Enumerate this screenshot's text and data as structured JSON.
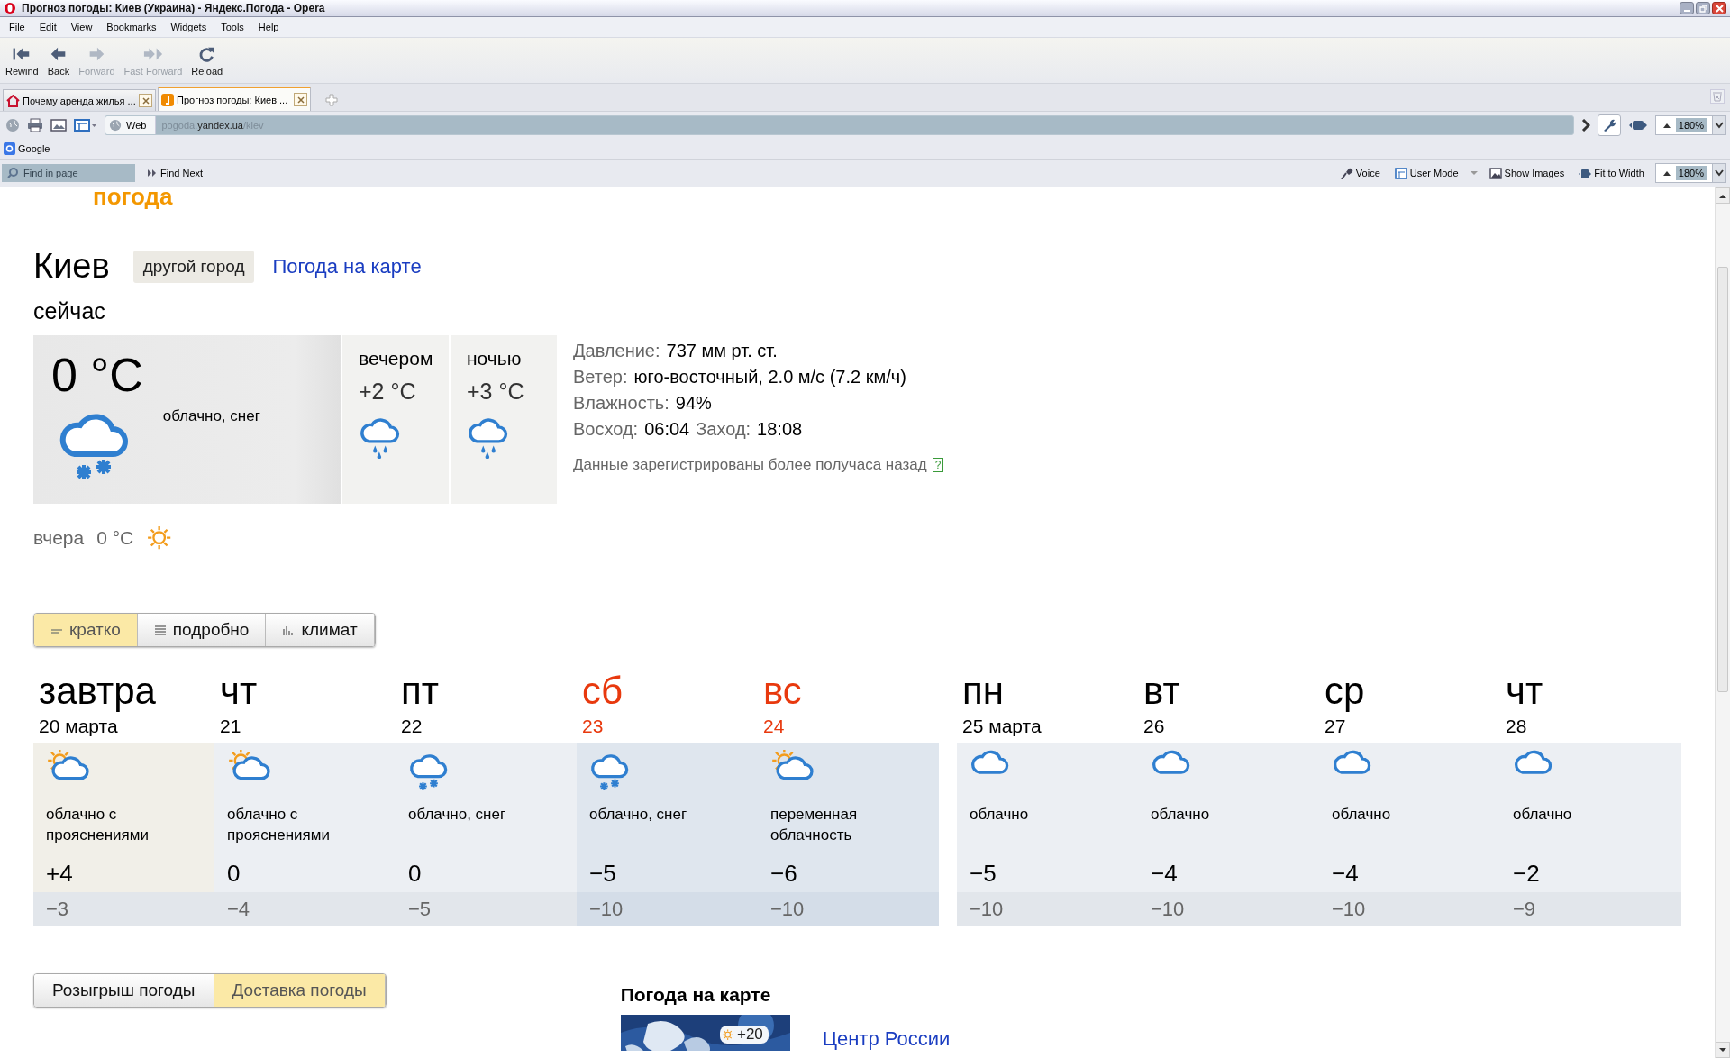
{
  "window": {
    "title": "Прогноз погоды: Киев (Украина) - Яндекс.Погода - Opera"
  },
  "menu": [
    "File",
    "Edit",
    "View",
    "Bookmarks",
    "Widgets",
    "Tools",
    "Help"
  ],
  "toolbar": [
    {
      "label": "Rewind",
      "disabled": false
    },
    {
      "label": "Back",
      "disabled": false
    },
    {
      "label": "Forward",
      "disabled": true
    },
    {
      "label": "Fast Forward",
      "disabled": true
    },
    {
      "label": "Reload",
      "disabled": false
    }
  ],
  "tabs": [
    {
      "title": "Почему аренда жилья ...",
      "selected": false
    },
    {
      "title": "Прогноз погоды: Киев ...",
      "selected": true
    }
  ],
  "address": {
    "scope": "Web",
    "prefix": "pogoda.",
    "host": "yandex.ua",
    "path": "/kiev"
  },
  "zoom": "180%",
  "bookmarks": [
    "Google"
  ],
  "find_bar": {
    "placeholder": "Find in page",
    "button": "Find Next"
  },
  "view_tools": [
    "Voice",
    "User Mode",
    "Show Images",
    "Fit to Width"
  ],
  "find_zoom": "180%",
  "page": {
    "logo": "погода",
    "city": "Киев",
    "other_city": "другой город",
    "map_link": "Погода на карте",
    "now_label": "сейчас",
    "current": {
      "temp": "0 °C",
      "condition": "облачно, снег",
      "kind": "snow"
    },
    "parts": [
      {
        "label": "вечером",
        "temp": "+2 °C",
        "kind": "rain"
      },
      {
        "label": "ночью",
        "temp": "+3 °C",
        "kind": "rain"
      }
    ],
    "details": [
      [
        {
          "label": "Давление:",
          "value": "737 мм рт. ст."
        }
      ],
      [
        {
          "label": "Ветер:",
          "value": "юго-восточный, 2.0 м/с (7.2 км/ч)"
        }
      ],
      [
        {
          "label": "Влажность:",
          "value": "94%"
        }
      ],
      [
        {
          "label": "Восход:",
          "value": "06:04"
        },
        {
          "label": "Заход:",
          "value": "18:08"
        }
      ]
    ],
    "note": "Данные зарегистрированы более получаса назад",
    "help": "?",
    "yesterday": {
      "label": "вчера",
      "temp": "0 °C",
      "kind": "sun"
    },
    "view_tabs": [
      {
        "label": "кратко",
        "selected": true
      },
      {
        "label": "подробно",
        "selected": false
      },
      {
        "label": "климат",
        "selected": false
      }
    ],
    "forecast_groups": [
      [
        {
          "day": "завтра",
          "date": "20 марта",
          "weekend": false,
          "kind": "partly",
          "condition": "облачно с прояснениями",
          "high": "+4",
          "low": "−3"
        },
        {
          "day": "чт",
          "date": "21",
          "weekend": false,
          "kind": "partly",
          "condition": "облачно с прояснениями",
          "high": "0",
          "low": "−4"
        },
        {
          "day": "пт",
          "date": "22",
          "weekend": false,
          "kind": "snow",
          "condition": "облачно, снег",
          "high": "0",
          "low": "−5"
        },
        {
          "day": "сб",
          "date": "23",
          "weekend": true,
          "kind": "snow",
          "condition": "облачно, снег",
          "high": "−5",
          "low": "−10"
        },
        {
          "day": "вс",
          "date": "24",
          "weekend": true,
          "kind": "partly",
          "condition": "переменная облачность",
          "high": "−6",
          "low": "−10"
        }
      ],
      [
        {
          "day": "пн",
          "date": "25 марта",
          "weekend": false,
          "kind": "cloud",
          "condition": "облачно",
          "high": "−5",
          "low": "−10"
        },
        {
          "day": "вт",
          "date": "26",
          "weekend": false,
          "kind": "cloud",
          "condition": "облачно",
          "high": "−4",
          "low": "−10"
        },
        {
          "day": "ср",
          "date": "27",
          "weekend": false,
          "kind": "cloud",
          "condition": "облачно",
          "high": "−4",
          "low": "−10"
        },
        {
          "day": "чт",
          "date": "28",
          "weekend": false,
          "kind": "cloud",
          "condition": "облачно",
          "high": "−2",
          "low": "−9"
        }
      ]
    ],
    "bottom_tabs": [
      {
        "label": "Розыгрыш погоды",
        "selected": false
      },
      {
        "label": "Доставка погоды",
        "selected": true
      }
    ],
    "map_section": {
      "title": "Погода на карте",
      "badge": "+20",
      "link": "Центр России"
    }
  }
}
